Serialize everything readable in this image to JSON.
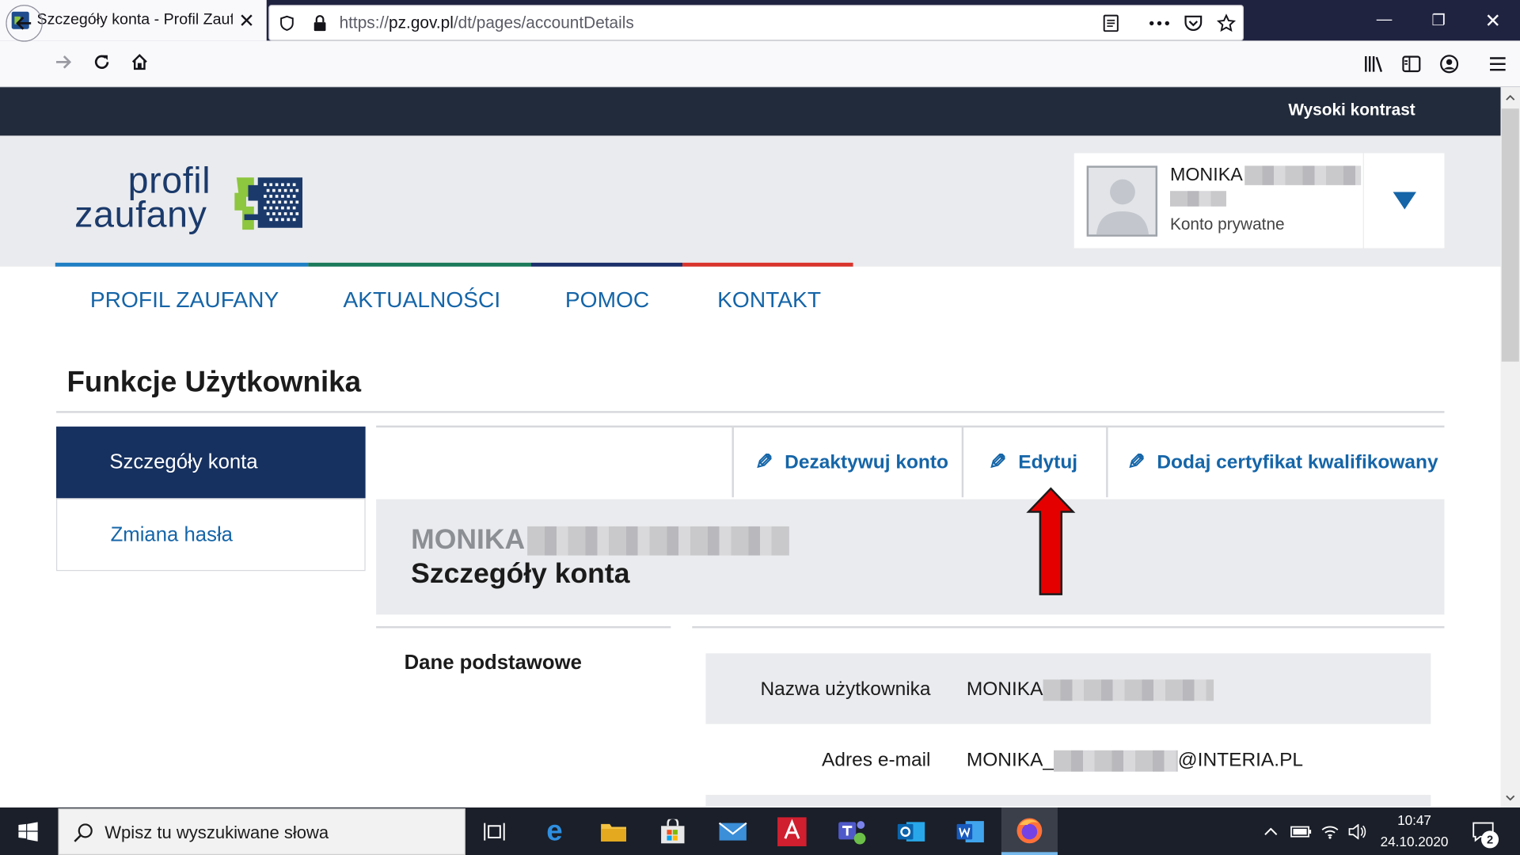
{
  "browser": {
    "tab_title": "Szczegóły konta - Profil Zaufany",
    "tab_close": "✕",
    "new_tab": "+",
    "url_prefix": "https://",
    "url_domain": "pz.gov.pl",
    "url_path": "/dt/pages/accountDetails",
    "window_minimize": "—",
    "window_restore": "❐",
    "window_close": "✕"
  },
  "page": {
    "high_contrast": "Wysoki kontrast",
    "logo_line1": "profil",
    "logo_line2": "zaufany",
    "user": {
      "name": "MONIKA",
      "account_type": "Konto prywatne"
    },
    "menu": [
      "PROFIL ZAUFANY",
      "AKTUALNOŚCI",
      "POMOC",
      "KONTAKT"
    ],
    "section_title": "Funkcje Użytkownika",
    "sidebar": [
      "Szczegóły konta",
      "Zmiana hasła"
    ],
    "actions": [
      "Dezaktywuj konto",
      "Edytuj",
      "Dodaj certyfikat kwalifikowany"
    ],
    "account_name": "MONIKA",
    "account_heading": "Szczegóły konta",
    "basic_data": "Dane podstawowe",
    "fields": [
      {
        "label": "Nazwa użytkownika",
        "value": "MONIKA"
      },
      {
        "label": "Adres e-mail",
        "value_prefix": "MONIKA_",
        "value_suffix": "@INTERIA.PL"
      }
    ]
  },
  "taskbar": {
    "search_placeholder": "Wpisz tu wyszukiwane słowa",
    "time": "10:47",
    "date": "24.10.2020",
    "notifications": "2"
  },
  "colors": {
    "accent": "#1565a8",
    "sidebar_active": "#16305f",
    "arrow": "#e50000"
  }
}
